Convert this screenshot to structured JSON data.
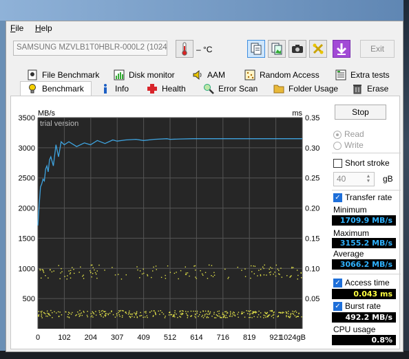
{
  "menu": {
    "file_rest": "ile",
    "file_first": "F",
    "help_first": "H",
    "help_rest": "elp"
  },
  "toolbar": {
    "drive": "SAMSUNG MZVLB1T0HBLR-000L2 (1024",
    "temperature": "– °C",
    "exit_label": "Exit"
  },
  "tabs": {
    "row1": [
      "File Benchmark",
      "Disk monitor",
      "AAM",
      "Random Access",
      "Extra tests"
    ],
    "row2": [
      "Benchmark",
      "Info",
      "Health",
      "Error Scan",
      "Folder Usage",
      "Erase"
    ]
  },
  "chart": {
    "left_unit": "MB/s",
    "right_unit": "ms",
    "watermark": "trial version",
    "y_left_ticks": [
      "3500",
      "3000",
      "2500",
      "2000",
      "1500",
      "1000",
      "500"
    ],
    "y_right_ticks": [
      "0.35",
      "0.30",
      "0.25",
      "0.20",
      "0.15",
      "0.10",
      "0.05"
    ],
    "x_ticks": [
      "0",
      "102",
      "204",
      "307",
      "409",
      "512",
      "614",
      "716",
      "819",
      "921",
      "1024gB"
    ],
    "transfer_color": "#3fa4e0",
    "access_color": "#e8e84a"
  },
  "chart_data": {
    "type": "line",
    "x_unit": "gB",
    "xlim": [
      0,
      1024
    ],
    "ylim_left": [
      0,
      3500
    ],
    "ylim_right": [
      0,
      0.35
    ],
    "series": [
      {
        "name": "Transfer rate",
        "axis": "left",
        "x": [
          0,
          5,
          10,
          15,
          20,
          25,
          30,
          35,
          40,
          45,
          50,
          60,
          70,
          80,
          90,
          102,
          120,
          150,
          180,
          204,
          230,
          260,
          290,
          307,
          340,
          380,
          409,
          450,
          500,
          512,
          550,
          600,
          700,
          800,
          900,
          1000,
          1024
        ],
        "y": [
          1710,
          2050,
          2350,
          2400,
          2480,
          2450,
          2650,
          2700,
          2600,
          2800,
          2850,
          2700,
          3050,
          2850,
          3100,
          3050,
          3100,
          3020,
          3080,
          3050,
          3120,
          3070,
          3130,
          3110,
          3130,
          3140,
          3120,
          3140,
          3150,
          3140,
          3145,
          3150,
          3150,
          3150,
          3150,
          3150,
          3150
        ]
      },
      {
        "name": "Access time",
        "axis": "right",
        "kind": "scatter",
        "clusters_ms": [
          0.025,
          0.095
        ]
      }
    ]
  },
  "side": {
    "stop_label": "Stop",
    "read_label": "Read",
    "write_label": "Write",
    "short_stroke_label": "Short stroke",
    "size_value": "40",
    "size_unit": "gB",
    "transfer_rate_label": "Transfer rate",
    "minimum_label": "Minimum",
    "minimum_value": "1709.9 MB/s",
    "maximum_label": "Maximum",
    "maximum_value": "3155.2 MB/s",
    "average_label": "Average",
    "average_value": "3066.2 MB/s",
    "access_time_label": "Access time",
    "access_time_value": "0.043 ms",
    "burst_rate_label": "Burst rate",
    "burst_rate_value": "492.2 MB/s",
    "cpu_usage_label": "CPU usage",
    "cpu_usage_value": "0.8%",
    "value_color_blue": "#2fb2ff",
    "value_color_yellow": "#ffff40",
    "value_color_white": "#ffffff"
  }
}
